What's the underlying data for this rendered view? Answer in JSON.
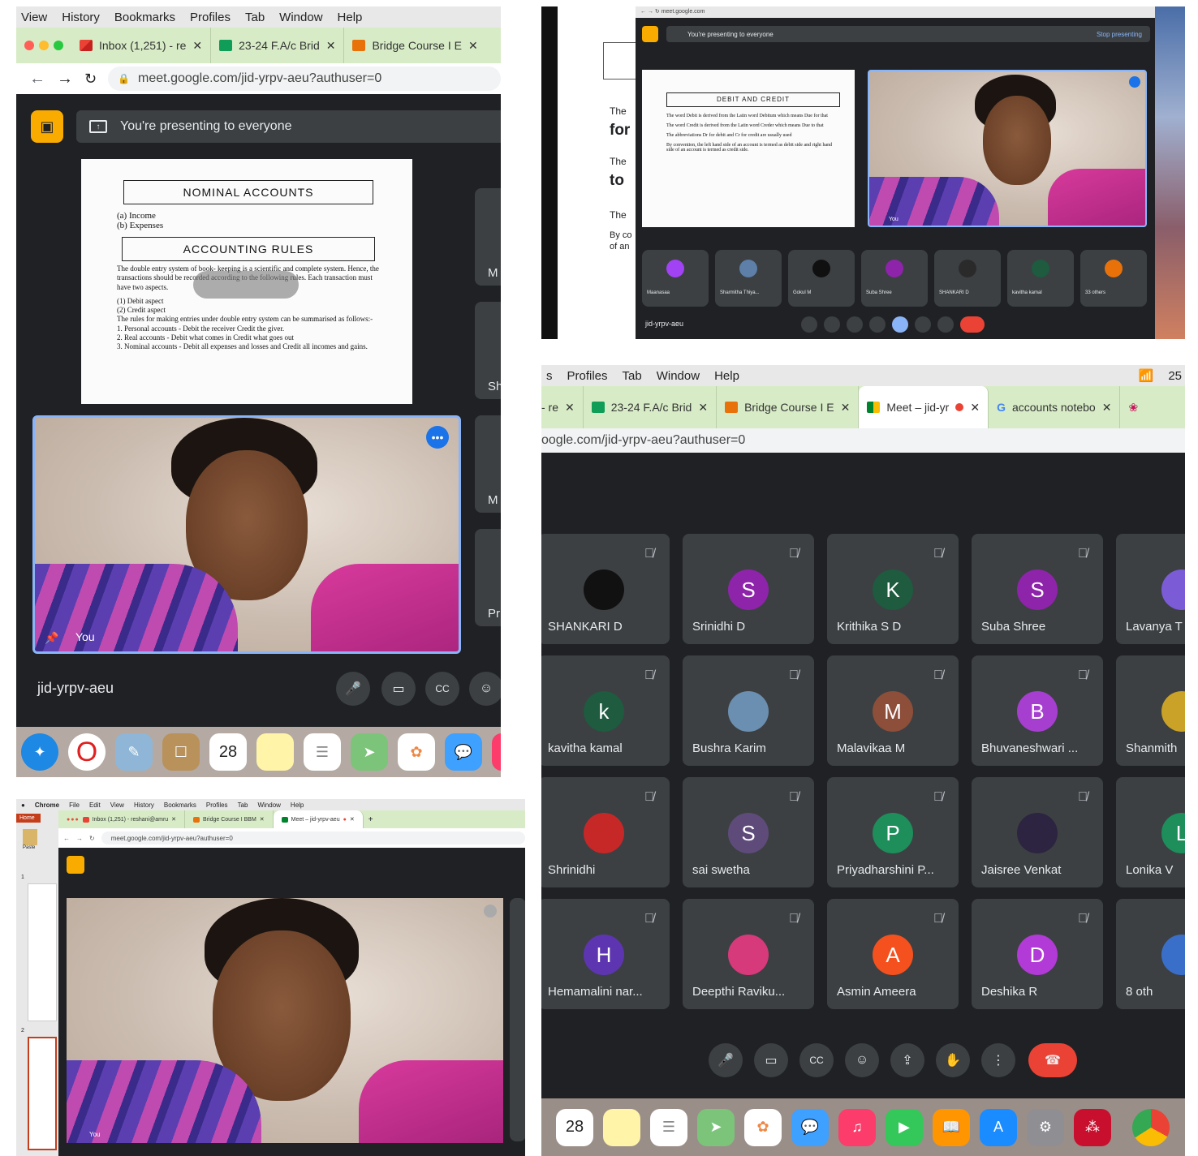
{
  "panel_tl": {
    "menu": [
      "View",
      "History",
      "Bookmarks",
      "Profiles",
      "Tab",
      "Window",
      "Help"
    ],
    "tabs": [
      {
        "label": "Inbox (1,251) - re",
        "favicon": "gmail-icon"
      },
      {
        "label": "23-24 F.A/c Brid",
        "favicon": "sheets-icon"
      },
      {
        "label": "Bridge Course I E",
        "favicon": "slides-icon"
      }
    ],
    "url": "meet.google.com/jid-yrpv-aeu?authuser=0",
    "presenting_banner": "You're presenting to everyone",
    "slide": {
      "title1": "NOMINAL ACCOUNTS",
      "items": [
        "(a) Income",
        "(b) Expenses"
      ],
      "title2": "ACCOUNTING RULES",
      "body": "The double entry system of book- keeping is a scientific and complete system. Hence, the transactions should be recorded according to the following rules. Each transaction must have two aspects.",
      "aspects": [
        "(1) Debit aspect",
        "(2) Credit aspect"
      ],
      "rules_intro": "The rules for making entries under double entry system can be summarised as follows:-",
      "rules": [
        "1. Personal accounts - Debit the receiver Credit the giver.",
        "2. Real accounts - Debit what comes in Credit what goes out",
        "3. Nominal accounts - Debit all expenses and losses and Credit all incomes and gains."
      ]
    },
    "self_label": "You",
    "side_labels": [
      "M",
      "Sh",
      "M",
      "Pr"
    ],
    "meeting_code": "jid-yrpv-aeu",
    "dock_date": "28"
  },
  "panel_tr": {
    "presenting_banner": "You're presenting to everyone",
    "stop_presenting": "Stop presenting",
    "slide_title": "DEBIT AND CREDIT",
    "slide_lines": [
      "The word Debit is derived from the Latin word Debitum which means Due for that",
      "The word Credit is derived from the Latin word Creder which means Due to that",
      "The abbreviations Dr for debit and Cr for credit are usually used",
      "By convention, the left hand side of an account is termed as debit side and right hand side of an account is termed as credit side."
    ],
    "left_fragments": [
      "The",
      "for",
      "The",
      "to",
      "The",
      "By co",
      "of an"
    ],
    "self_label": "You",
    "participants": [
      "Maanasaa",
      "Sharmitha Thiya...",
      "Gokul M",
      "Suba Shree",
      "SHANKARI D",
      "kavitha kamal",
      "33 others"
    ],
    "meeting_code": "jid-yrpv-aeu"
  },
  "panel_br": {
    "menu": [
      "s",
      "Profiles",
      "Tab",
      "Window",
      "Help"
    ],
    "battery": "25",
    "tabs": [
      {
        "label": "- re",
        "favicon": "gmail-icon"
      },
      {
        "label": "23-24 F.A/c Brid",
        "favicon": "sheets-icon"
      },
      {
        "label": "Bridge Course I E",
        "favicon": "slides-icon"
      },
      {
        "label": "Meet – jid-yr",
        "favicon": "meet-icon",
        "active": true
      },
      {
        "label": "accounts notebo",
        "favicon": "google-icon"
      }
    ],
    "url": "oogle.com/jid-yrpv-aeu?authuser=0",
    "participants": [
      {
        "name": "SHANKARI D",
        "initial": "",
        "color": "#111111"
      },
      {
        "name": "Srinidhi D",
        "initial": "S",
        "color": "#8e24aa"
      },
      {
        "name": "Krithika S D",
        "initial": "K",
        "color": "#1e5b3f"
      },
      {
        "name": "Suba Shree",
        "initial": "S",
        "color": "#8e24aa"
      },
      {
        "name": "Lavanya T",
        "initial": "",
        "color": "#7b5cd6"
      },
      {
        "name": "kavitha kamal",
        "initial": "k",
        "color": "#1e5b3f"
      },
      {
        "name": "Bushra Karim",
        "initial": "",
        "color": "#6b8fb0"
      },
      {
        "name": "Malavikaa M",
        "initial": "M",
        "color": "#8d4e3a"
      },
      {
        "name": "Bhuvaneshwari ...",
        "initial": "B",
        "color": "#a63fd0"
      },
      {
        "name": "Shanmith",
        "initial": "",
        "color": "#c9a227"
      },
      {
        "name": "Shrinidhi",
        "initial": "",
        "color": "#c62828"
      },
      {
        "name": "sai swetha",
        "initial": "S",
        "color": "#5e4b7a"
      },
      {
        "name": "Priyadharshini P...",
        "initial": "P",
        "color": "#1e8e5a"
      },
      {
        "name": "Jaisree Venkat",
        "initial": "",
        "color": "#2c2440"
      },
      {
        "name": "Lonika V",
        "initial": "L",
        "color": "#1e8e5a"
      },
      {
        "name": "Hemamalini nar...",
        "initial": "H",
        "color": "#5e35b1"
      },
      {
        "name": "Deepthi Raviku...",
        "initial": "",
        "color": "#d63a7a"
      },
      {
        "name": "Asmin Ameera",
        "initial": "A",
        "color": "#f4511e"
      },
      {
        "name": "Deshika R",
        "initial": "D",
        "color": "#b23ad6"
      },
      {
        "name": "8 oth",
        "initial": "",
        "color": "#3a6fc9"
      }
    ],
    "dock_date": "28"
  },
  "panel_bl": {
    "menu": [
      "Chrome",
      "File",
      "Edit",
      "View",
      "History",
      "Bookmarks",
      "Profiles",
      "Tab",
      "Window",
      "Help"
    ],
    "tabs": [
      {
        "label": "Inbox (1,251) - reshani@amru",
        "favicon": "gmail-icon"
      },
      {
        "label": "Bridge Course I BBM",
        "favicon": "slides-icon"
      },
      {
        "label": "Meet – jid-yrpv-aeu",
        "favicon": "meet-icon",
        "active": true
      }
    ],
    "url": "meet.google.com/jid-yrpv-aeu?authuser=0",
    "home_label": "Home",
    "paste_label": "Paste",
    "slide_nums": [
      "1",
      "2"
    ],
    "self_label": "You"
  }
}
